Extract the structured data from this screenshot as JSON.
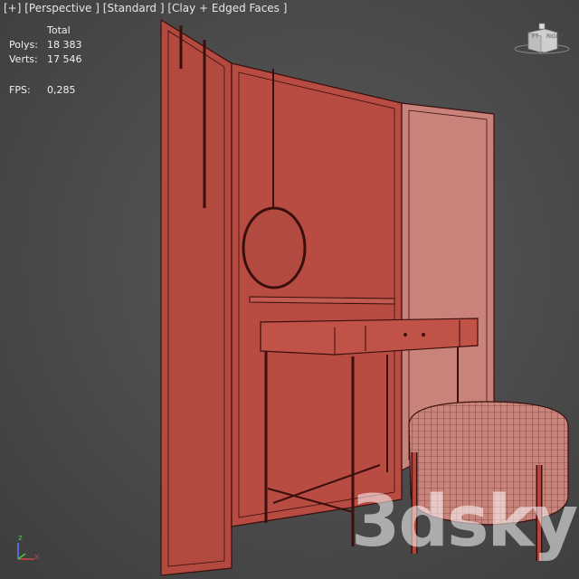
{
  "viewport_label": {
    "plus": "[+]",
    "view": "[Perspective ]",
    "shading": "[Standard ]",
    "mode": "[Clay + Edged Faces ]"
  },
  "stats": {
    "header": "Total",
    "polys_label": "Polys:",
    "polys_value": "18 383",
    "verts_label": "Verts:",
    "verts_value": "17 546",
    "fps_label": "FPS:",
    "fps_value": "0,285"
  },
  "viewcube": {
    "face_left": "FT",
    "face_right": "RIGHT"
  },
  "axis": {
    "x": "x",
    "y": "y",
    "z": "z"
  },
  "watermark": "3dsky",
  "colors": {
    "clay": "#b5453c",
    "clay_dark": "#8e2f28",
    "clay_light": "#c9786f",
    "wire": "#3a0f0c",
    "background": "#4d4d4d"
  }
}
